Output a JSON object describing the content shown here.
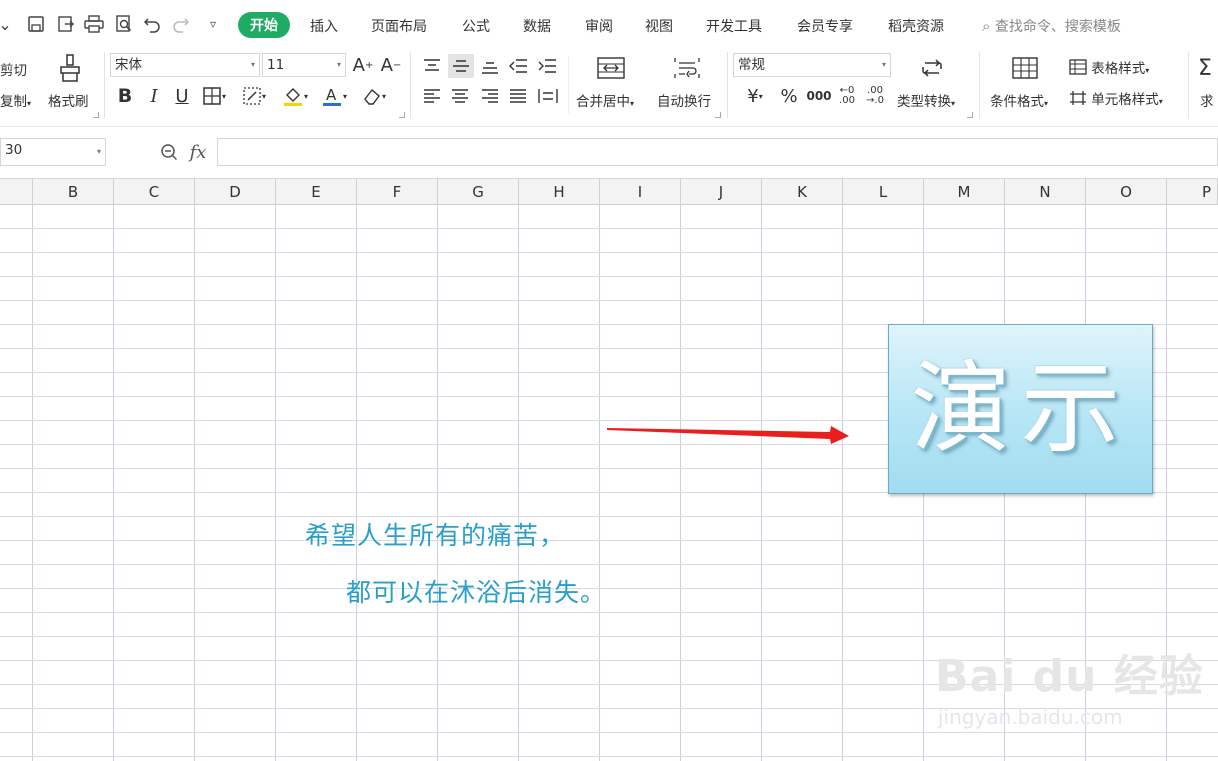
{
  "quick_access": {
    "items": [
      "chevron-down-icon",
      "save-icon",
      "export-icon",
      "print-icon",
      "print-preview-icon",
      "undo-icon",
      "redo-icon",
      "customize-icon"
    ]
  },
  "tabs": [
    {
      "label": "开始",
      "active": true
    },
    {
      "label": "插入"
    },
    {
      "label": "页面布局"
    },
    {
      "label": "公式"
    },
    {
      "label": "数据"
    },
    {
      "label": "审阅"
    },
    {
      "label": "视图"
    },
    {
      "label": "开发工具"
    },
    {
      "label": "会员专享"
    },
    {
      "label": "稻壳资源"
    }
  ],
  "search": {
    "placeholder": "查找命令、搜索模板"
  },
  "ribbon": {
    "cut": "剪切",
    "copy": "复制",
    "format_painter": "格式刷",
    "font_name": "宋体",
    "font_size": "11",
    "merge_center": "合并居中",
    "wrap_text": "自动换行",
    "number_format": "常规",
    "currency_symbol": "¥",
    "percent": "%",
    "thousands": "000",
    "dec_increase": ".00",
    "dec_decrease": ".0",
    "type_convert": "类型转换",
    "conditional_format": "条件格式",
    "table_style": "表格样式",
    "cell_style": "单元格样式",
    "sum_partial": "求"
  },
  "formula_bar": {
    "name_box": "30",
    "fx": "fx",
    "value": ""
  },
  "columns": [
    "B",
    "C",
    "D",
    "E",
    "F",
    "G",
    "H",
    "I",
    "J",
    "K",
    "L",
    "M",
    "N",
    "O",
    "P"
  ],
  "content": {
    "poem_line1": "希望人生所有的痛苦，",
    "poem_line2": "都可以在沐浴后消失。",
    "demo_text": "演示"
  },
  "watermark": {
    "line1": "Bai du 经验",
    "line2": "jingyan.baidu.com"
  },
  "colors": {
    "accent": "#1fab64",
    "poem": "#2a9fc9",
    "arrow": "#e8201d"
  }
}
